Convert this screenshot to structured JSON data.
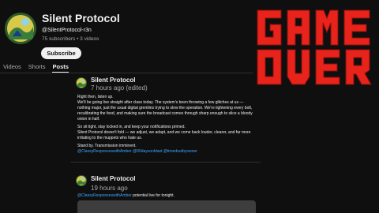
{
  "channel": {
    "name": "Silent Protocol",
    "handle": "@SilentProtocol-r3n",
    "meta": "75 subscribers • 3 videos",
    "subscribe_label": "Subscribe"
  },
  "tabs": [
    {
      "label": "Videos"
    },
    {
      "label": "Shorts"
    },
    {
      "label": "Posts",
      "active": true
    }
  ],
  "posts": [
    {
      "author": "Silent Protocol",
      "time": "7 hours ago (edited)",
      "paragraphs": [
        "Right then, listen up.\nWe'll be going live straight after class today. The system's been throwing a few glitches at us — nothing major, just the usual digital gremlins trying to slow the operation. We're tightening every bolt, recalibrating the feed, and making sure the broadcast comes through sharp enough to slice a bloody onion in half.",
        "So sit tight, stay locked in, and keep your notifications primed.\nSilent Protocol doesn't fold — we adjust, we adapt, and we come back louder, clearer, and far more irritating to the muppets who hate us.",
        "Stand by. Transmission imminent."
      ],
      "mentions": "@ClassyResponseswithAmber @90daysonblast @timedoutbyowner"
    },
    {
      "author": "Silent Protocol",
      "time": "19 hours ago",
      "mention": "@ClassyResponseswithAmber",
      "text": "potential live for tonight."
    }
  ],
  "overlay": {
    "line1": "GAME",
    "line2": "OVER",
    "color": "#e8231b"
  }
}
